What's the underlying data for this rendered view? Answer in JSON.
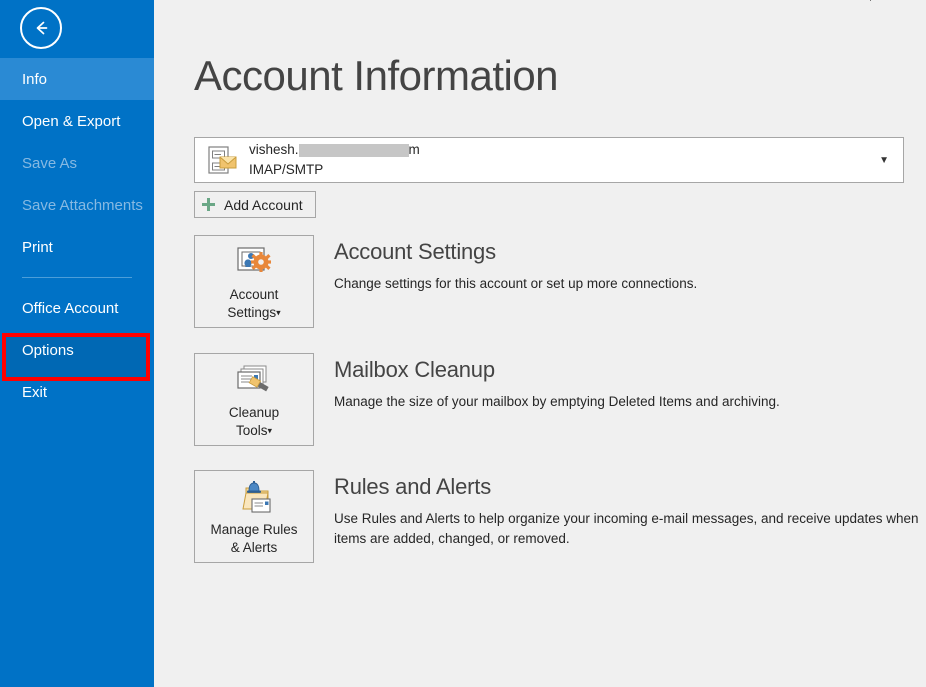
{
  "window": {
    "corner_glyph": "⌐"
  },
  "sidebar": {
    "back_button": "back-arrow-icon",
    "items": [
      {
        "label": "Info",
        "state": "active"
      },
      {
        "label": "Open & Export",
        "state": "normal"
      },
      {
        "label": "Save As",
        "state": "disabled"
      },
      {
        "label": "Save Attachments",
        "state": "disabled"
      },
      {
        "label": "Print",
        "state": "normal"
      },
      {
        "label": "Office Account",
        "state": "normal"
      },
      {
        "label": "Options",
        "state": "highlighted"
      },
      {
        "label": "Exit",
        "state": "normal"
      }
    ],
    "colors": {
      "background": "#0072c6",
      "active": "#2a8ad4",
      "highlight_fill": "#0068b4",
      "disabled_text": "#86b9e2",
      "divider": "#4c9ed9"
    }
  },
  "main": {
    "title": "Account Information",
    "account": {
      "email_prefix": "vishesh.",
      "email_redacted": true,
      "email_suffix": "m",
      "type": "IMAP/SMTP",
      "icon": "mail-account-icon",
      "chevron": "▼"
    },
    "add_account": {
      "label": "Add Account",
      "icon": "plus-icon"
    },
    "features": [
      {
        "id": "account",
        "button_line1": "Account",
        "button_line2": "Settings",
        "has_caret": true,
        "caret": "▾",
        "icon": "account-settings-icon",
        "title": "Account Settings",
        "description": "Change settings for this account or set up more connections."
      },
      {
        "id": "cleanup",
        "button_line1": "Cleanup",
        "button_line2": "Tools",
        "has_caret": true,
        "caret": "▾",
        "icon": "cleanup-tools-icon",
        "title": "Mailbox Cleanup",
        "description": "Manage the size of your mailbox by emptying Deleted Items and archiving."
      },
      {
        "id": "rules",
        "button_line1": "Manage Rules",
        "button_line2": "& Alerts",
        "has_caret": false,
        "caret": "",
        "icon": "rules-alerts-icon",
        "title": "Rules and Alerts",
        "description": "Use Rules and Alerts to help organize your incoming e-mail messages, and receive updates when items are added, changed, or removed."
      }
    ]
  },
  "annotation": {
    "target": "Options",
    "color": "#ff0000"
  }
}
